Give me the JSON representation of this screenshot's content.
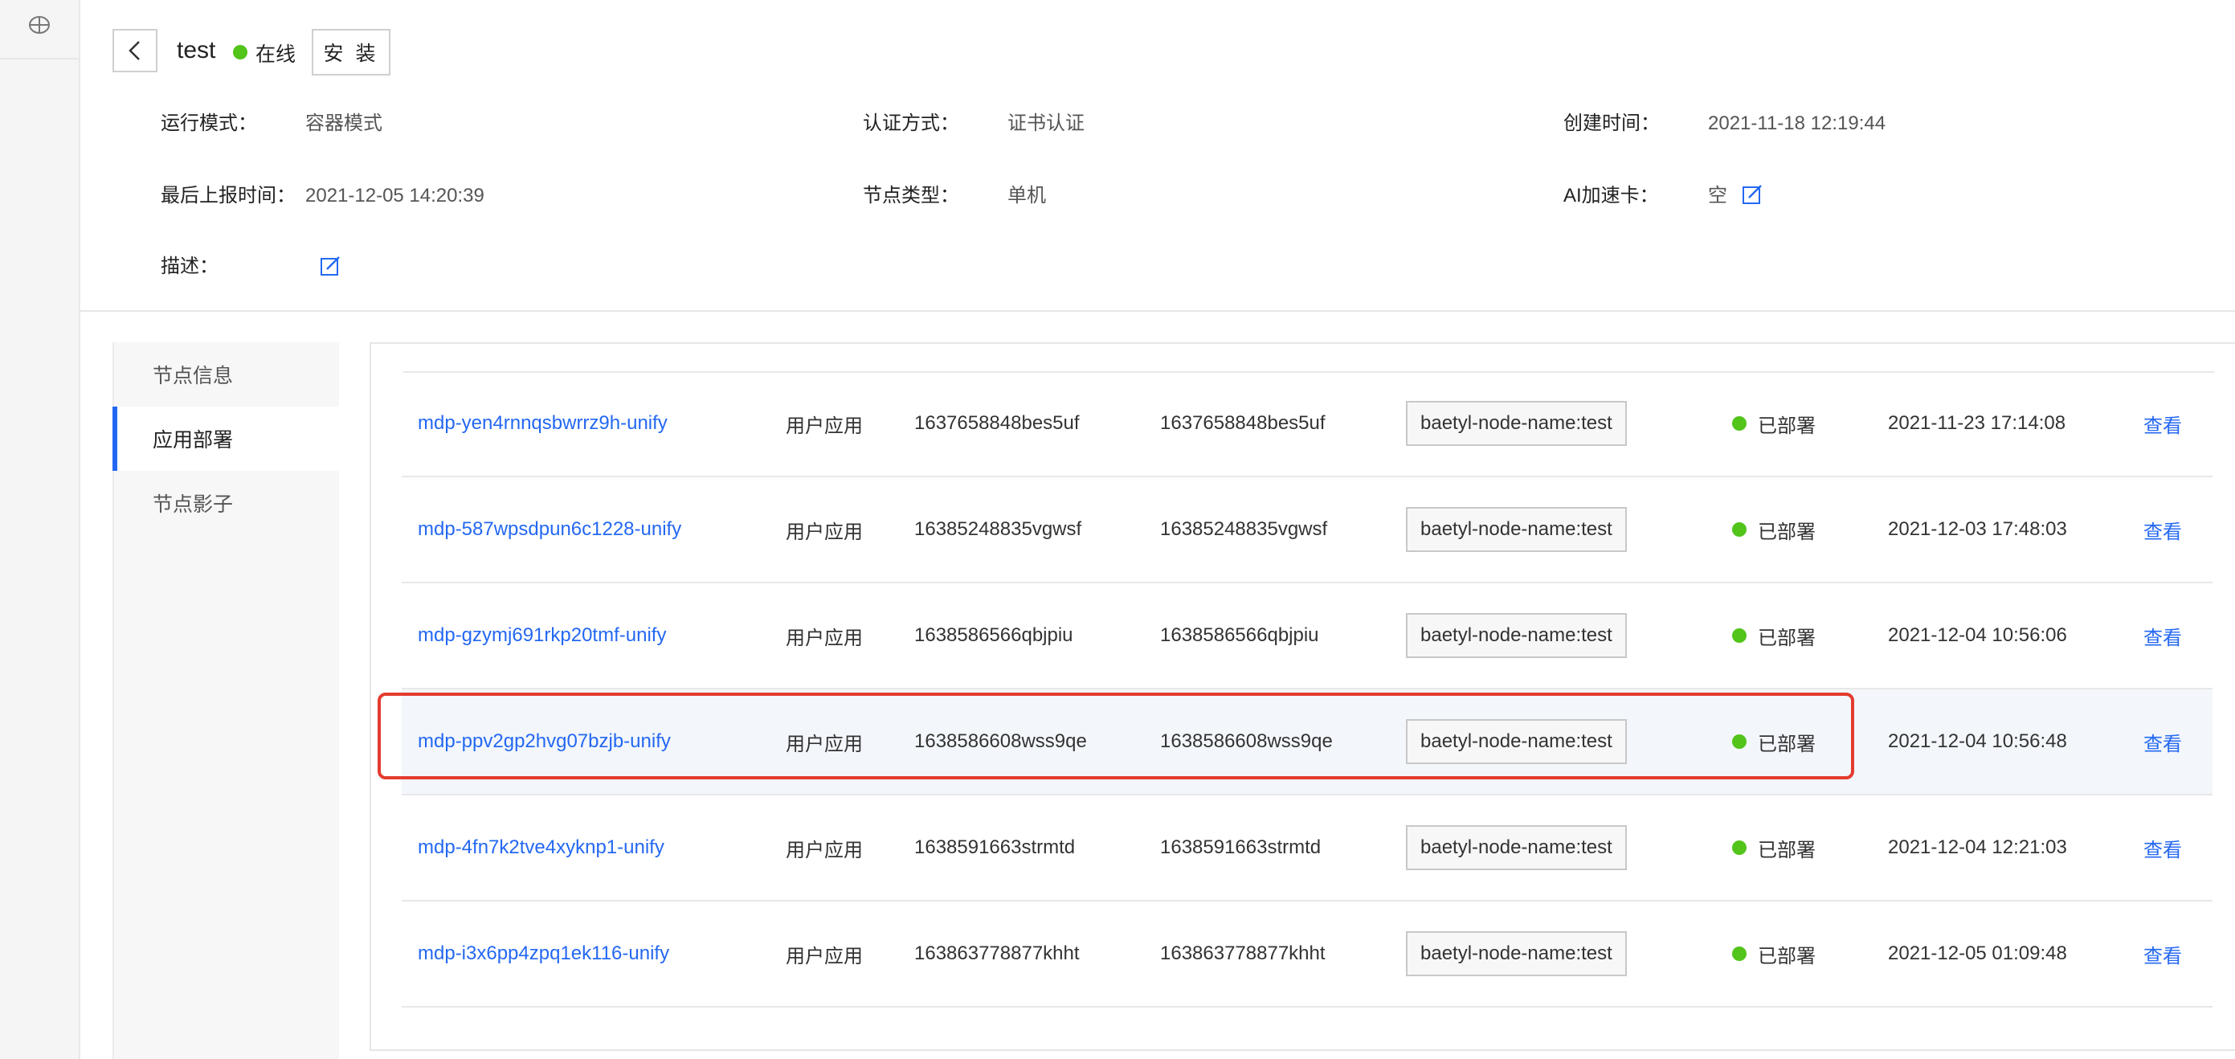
{
  "header": {
    "node_name": "test",
    "status": "在线",
    "install_button": "安 装",
    "info": {
      "run_mode_label": "运行模式：",
      "run_mode_value": "容器模式",
      "auth_label": "认证方式：",
      "auth_value": "证书认证",
      "created_label": "创建时间：",
      "created_value": "2021-11-18 12:19:44",
      "last_report_label": "最后上报时间：",
      "last_report_value": "2021-12-05 14:20:39",
      "node_type_label": "节点类型：",
      "node_type_value": "单机",
      "ai_card_label": "AI加速卡：",
      "ai_card_value": "空",
      "desc_label": "描述："
    }
  },
  "sidebar": {
    "tabs": [
      {
        "label": "节点信息",
        "active": false
      },
      {
        "label": "应用部署",
        "active": true
      },
      {
        "label": "节点影子",
        "active": false
      }
    ]
  },
  "table": {
    "rows": [
      {
        "name": "mdp-yen4rnnqsbwrrz9h-unify",
        "type": "用户应用",
        "id1": "1637658848bes5uf",
        "id2": "1637658848bes5uf",
        "tag": "baetyl-node-name:test",
        "status": "已部署",
        "time": "2021-11-23 17:14:08",
        "action": "查看"
      },
      {
        "name": "mdp-587wpsdpun6c1228-unify",
        "type": "用户应用",
        "id1": "16385248835vgwsf",
        "id2": "16385248835vgwsf",
        "tag": "baetyl-node-name:test",
        "status": "已部署",
        "time": "2021-12-03 17:48:03",
        "action": "查看"
      },
      {
        "name": "mdp-gzymj691rkp20tmf-unify",
        "type": "用户应用",
        "id1": "1638586566qbjpiu",
        "id2": "1638586566qbjpiu",
        "tag": "baetyl-node-name:test",
        "status": "已部署",
        "time": "2021-12-04 10:56:06",
        "action": "查看"
      },
      {
        "name": "mdp-ppv2gp2hvg07bzjb-unify",
        "type": "用户应用",
        "id1": "1638586608wss9qe",
        "id2": "1638586608wss9qe",
        "tag": "baetyl-node-name:test",
        "status": "已部署",
        "time": "2021-12-04 10:56:48",
        "action": "查看"
      },
      {
        "name": "mdp-4fn7k2tve4xyknp1-unify",
        "type": "用户应用",
        "id1": "1638591663strmtd",
        "id2": "1638591663strmtd",
        "tag": "baetyl-node-name:test",
        "status": "已部署",
        "time": "2021-12-04 12:21:03",
        "action": "查看"
      },
      {
        "name": "mdp-i3x6pp4zpq1ek116-unify",
        "type": "用户应用",
        "id1": "163863778877khht",
        "id2": "163863778877khht",
        "tag": "baetyl-node-name:test",
        "status": "已部署",
        "time": "2021-12-05 01:09:48",
        "action": "查看"
      }
    ]
  },
  "colors": {
    "accent": "#2468f2",
    "status_green": "#52c41a",
    "highlight_frame": "#e43b2f"
  }
}
